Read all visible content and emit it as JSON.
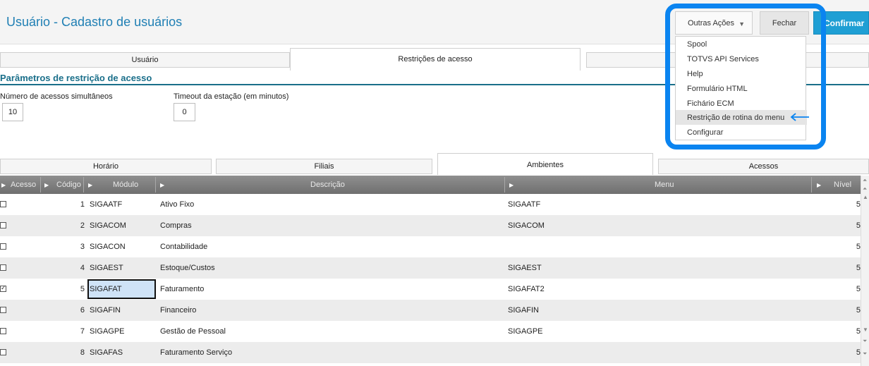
{
  "header": {
    "title": "Usuário - Cadastro de usuários",
    "other_actions_label": "Outras Ações",
    "close_label": "Fechar",
    "confirm_label": "Confirmar"
  },
  "dropdown": {
    "items": [
      {
        "label": "Spool"
      },
      {
        "label": "TOTVS API Services"
      },
      {
        "label": "Help"
      },
      {
        "label": "Formulário HTML"
      },
      {
        "label": "Fichário ECM"
      },
      {
        "label": "Restrição de rotina do menu"
      },
      {
        "label": "Configurar"
      }
    ],
    "hovered_index": 5
  },
  "main_tabs": [
    {
      "label": "Usuário"
    },
    {
      "label": "Restrições de acesso"
    }
  ],
  "section": {
    "title": "Parâmetros de restrição de acesso",
    "fields": [
      {
        "label": "Número de acessos simultâneos",
        "value": "10"
      },
      {
        "label": "Timeout da estação (em minutos)",
        "value": "0"
      }
    ]
  },
  "sub_tabs": [
    {
      "label": "Horário"
    },
    {
      "label": "Filiais"
    },
    {
      "label": "Ambientes"
    },
    {
      "label": "Acessos"
    }
  ],
  "grid": {
    "columns": [
      "Acesso",
      "Código",
      "Módulo",
      "Descrição",
      "Menu",
      "Nível"
    ],
    "rows": [
      {
        "checked": false,
        "code": "1",
        "module": "SIGAATF",
        "description": "Ativo Fixo",
        "menu": "SIGAATF",
        "level": "5"
      },
      {
        "checked": false,
        "code": "2",
        "module": "SIGACOM",
        "description": "Compras",
        "menu": "SIGACOM",
        "level": "5"
      },
      {
        "checked": false,
        "code": "3",
        "module": "SIGACON",
        "description": "Contabilidade",
        "menu": "",
        "level": "5"
      },
      {
        "checked": false,
        "code": "4",
        "module": "SIGAEST",
        "description": "Estoque/Custos",
        "menu": "SIGAEST",
        "level": "5"
      },
      {
        "checked": true,
        "code": "5",
        "module": "SIGAFAT",
        "description": "Faturamento",
        "menu": "SIGAFAT2",
        "level": "5"
      },
      {
        "checked": false,
        "code": "6",
        "module": "SIGAFIN",
        "description": "Financeiro",
        "menu": "SIGAFIN",
        "level": "5"
      },
      {
        "checked": false,
        "code": "7",
        "module": "SIGAGPE",
        "description": "Gestão de Pessoal",
        "menu": "SIGAGPE",
        "level": "5"
      },
      {
        "checked": false,
        "code": "8",
        "module": "SIGAFAS",
        "description": "Faturamento Serviço",
        "menu": "",
        "level": "5"
      }
    ]
  },
  "colors": {
    "accent": "#1f7fb4",
    "confirm": "#1f9fd4",
    "highlight": "#0a84f0",
    "section": "#1a6f8a"
  }
}
